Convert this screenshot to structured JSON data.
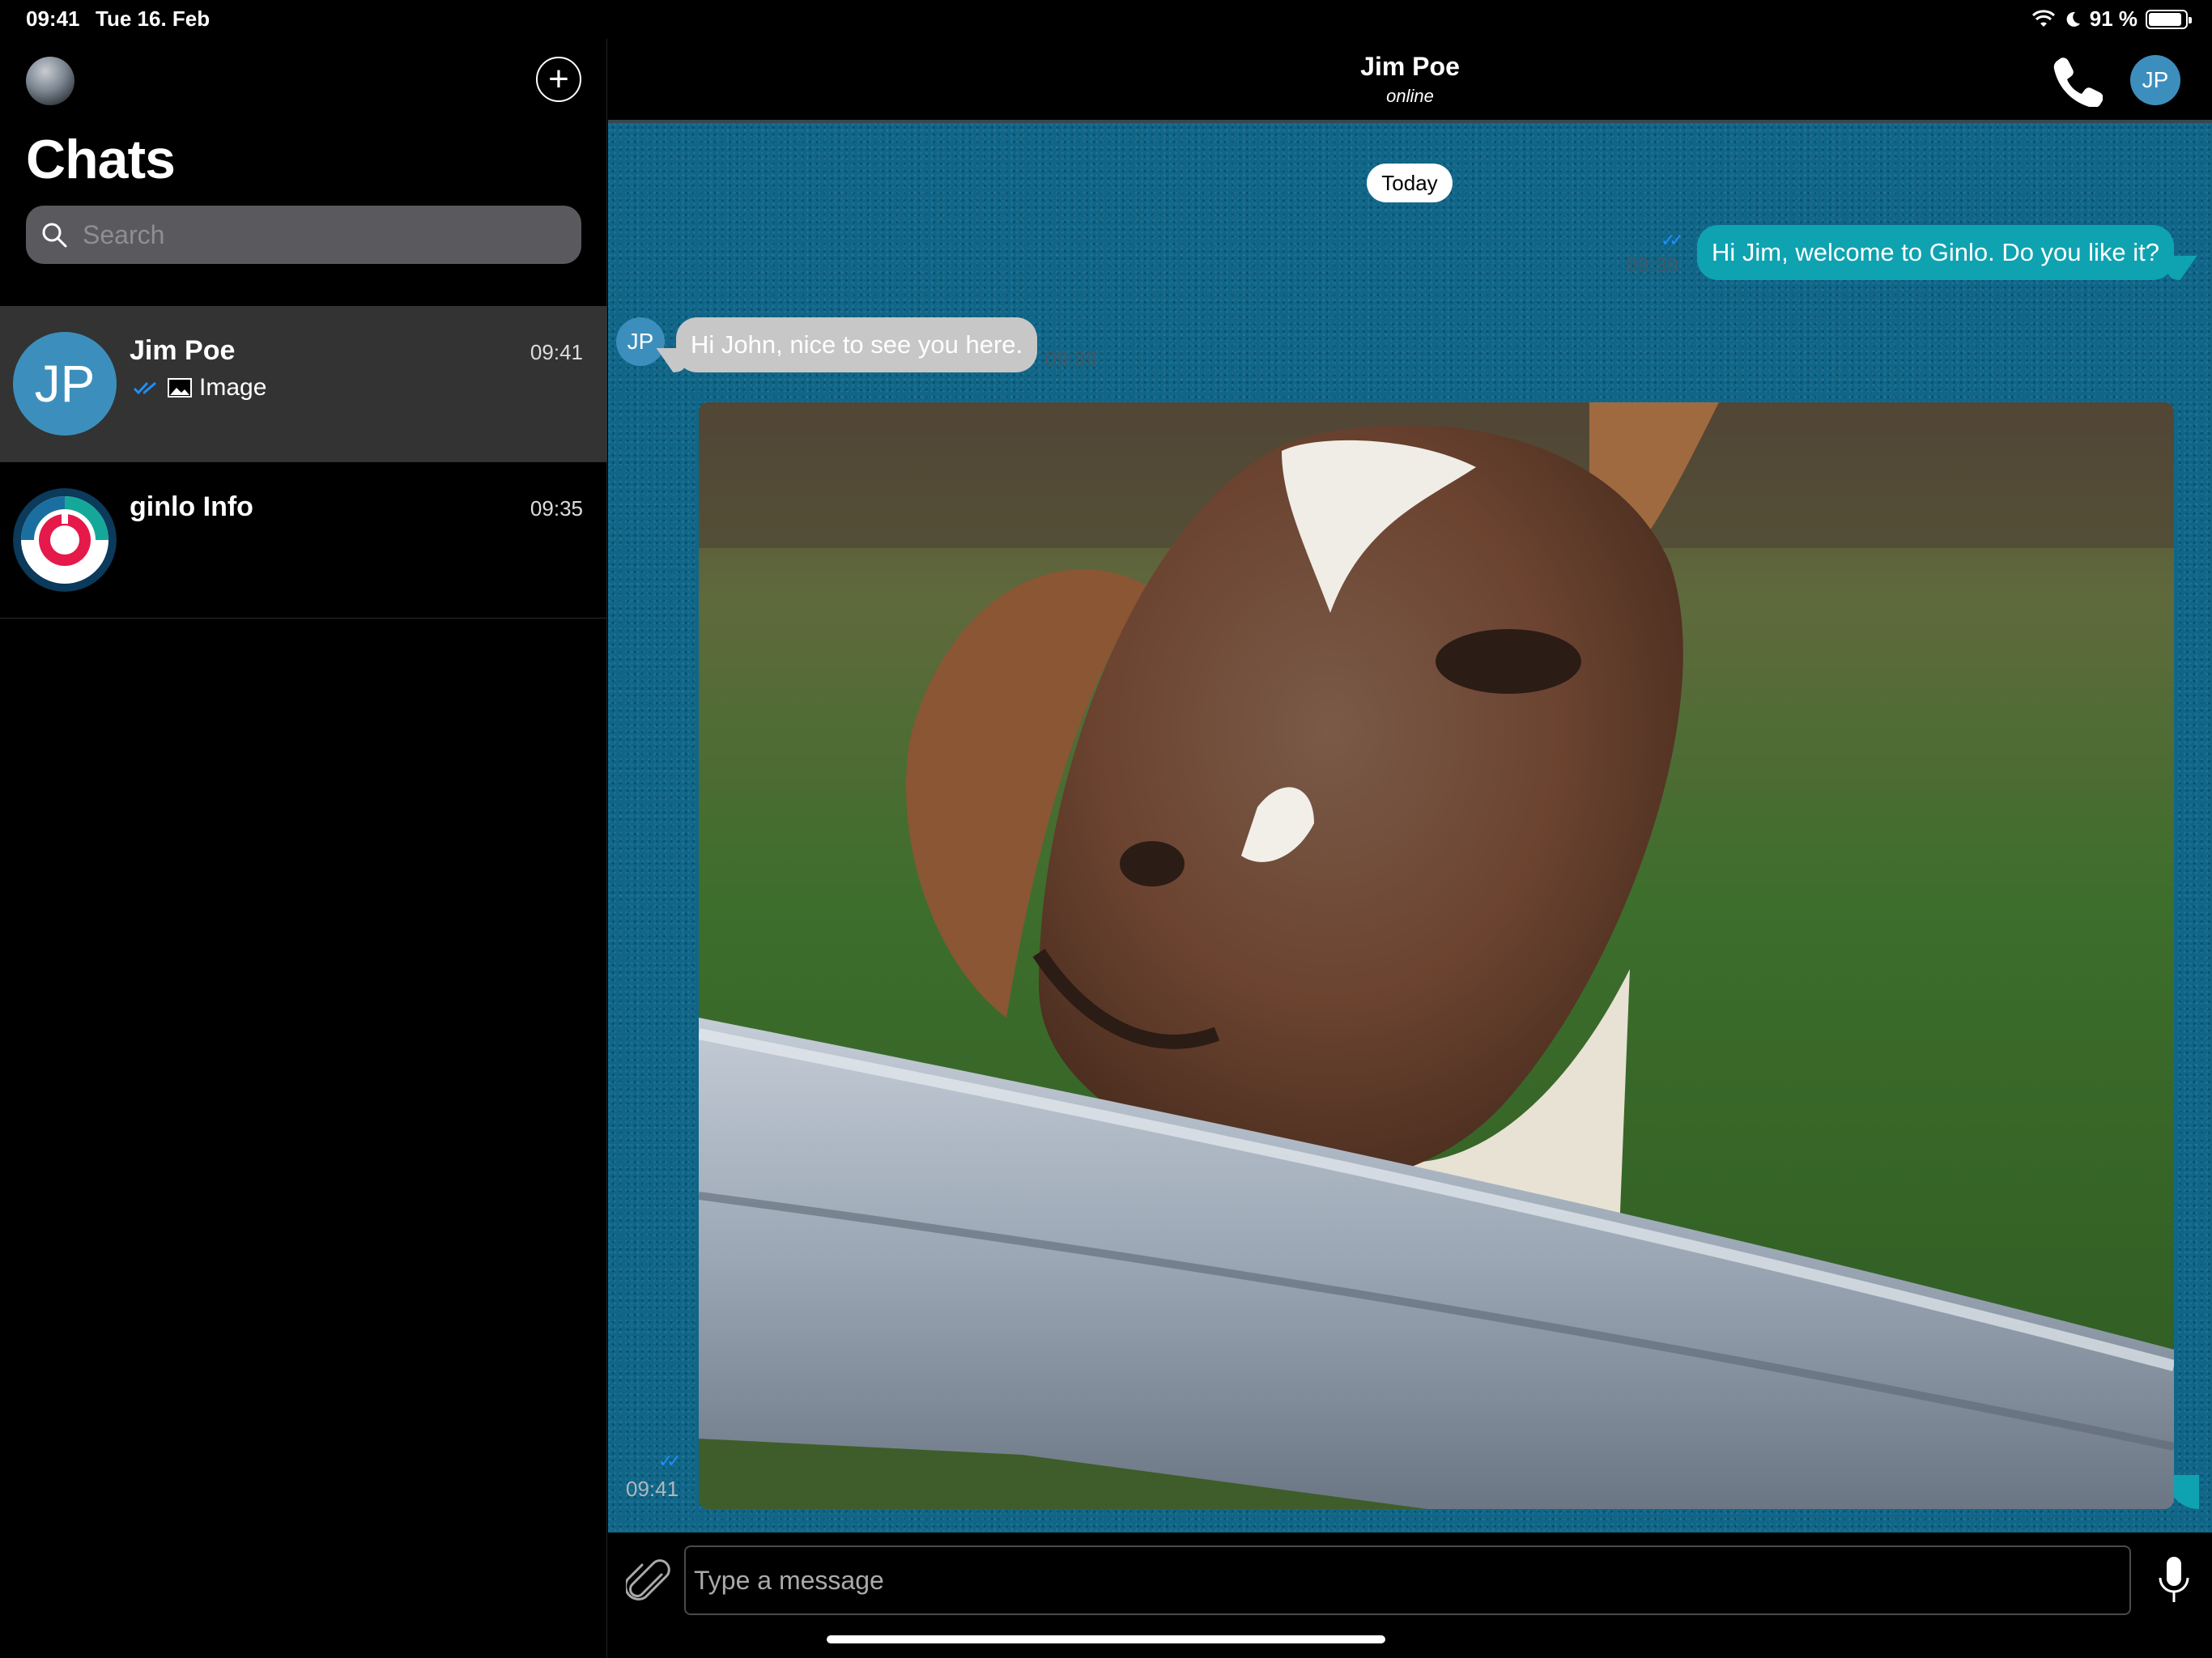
{
  "status_bar": {
    "time": "09:41",
    "date": "Tue 16. Feb",
    "battery_text": "91 %",
    "battery_level": 0.91
  },
  "sidebar": {
    "title": "Chats",
    "search_placeholder": "Search",
    "chats": [
      {
        "name": "Jim Poe",
        "initials": "JP",
        "time": "09:41",
        "preview": "Image",
        "active": true
      },
      {
        "name": "ginlo Info",
        "time": "09:35",
        "preview": ""
      }
    ]
  },
  "conversation": {
    "contact_name": "Jim Poe",
    "contact_status": "online",
    "contact_initials": "JP",
    "date_separator": "Today",
    "messages": [
      {
        "direction": "outgoing",
        "text": "Hi Jim, welcome to Ginlo. Do you like it?",
        "time": "09:39"
      },
      {
        "direction": "incoming",
        "sender_initials": "JP",
        "text": "Hi John, nice to see you here.",
        "time": "09:39"
      },
      {
        "direction": "outgoing",
        "type": "image",
        "time": "09:41"
      }
    ]
  },
  "composer": {
    "placeholder": "Type a message"
  },
  "colors": {
    "accent_outgoing": "#0fa3b1",
    "incoming_bubble": "#c7c7c7",
    "avatar_blue": "#3c8fbd",
    "read_tick": "#1e8fff"
  }
}
